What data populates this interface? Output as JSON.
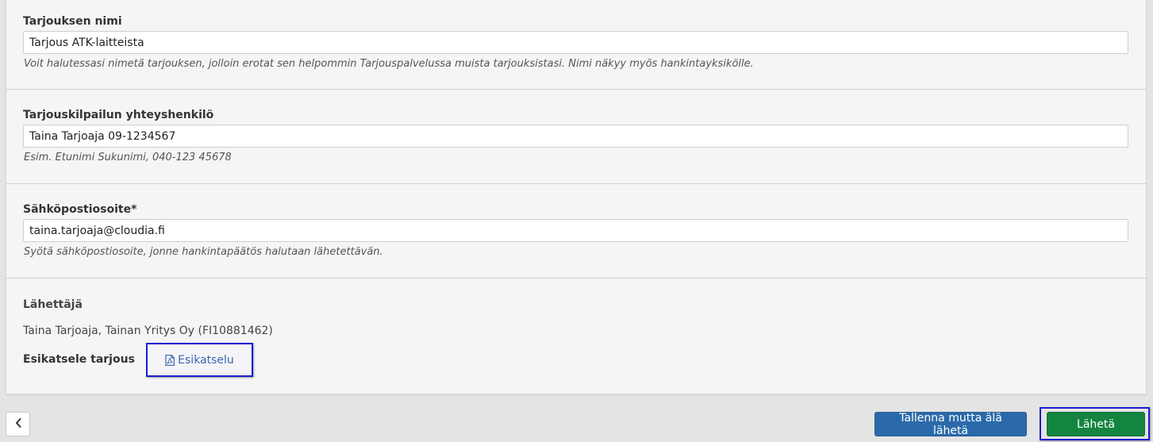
{
  "offer_name": {
    "label": "Tarjouksen nimi",
    "value": "Tarjous ATK-laitteista",
    "help": "Voit halutessasi nimetä tarjouksen, jolloin erotat sen helpommin Tarjouspalvelussa muista tarjouksistasi. Nimi näkyy myös hankintayksikölle."
  },
  "contact_person": {
    "label": "Tarjouskilpailun yhteyshenkilö",
    "value": "Taina Tarjoaja 09-1234567",
    "help": "Esim. Etunimi Sukunimi, 040-123 45678"
  },
  "email": {
    "label": "Sähköpostiosoite*",
    "value": "taina.tarjoaja@cloudia.fi",
    "help": "Syötä sähköpostiosoite, jonne hankintapäätös halutaan lähetettävän."
  },
  "sender": {
    "label": "Lähettäjä",
    "value": "Taina Tarjoaja, Tainan Yritys Oy (FI10881462)"
  },
  "preview": {
    "label": "Esikatsele tarjous",
    "link_label": "Esikatselu",
    "icon": "file-pdf-icon"
  },
  "footer": {
    "back_icon": "chevron-left-icon",
    "save_label": "Tallenna mutta älä lähetä",
    "send_label": "Lähetä"
  },
  "colors": {
    "save_button": "#2b6aaa",
    "send_button": "#14853f",
    "highlight": "#1b1bd0",
    "link": "#3d66b0"
  }
}
